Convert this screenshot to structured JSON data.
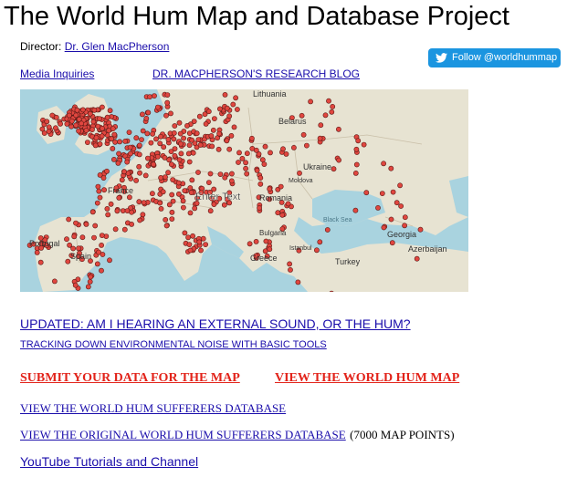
{
  "page": {
    "title": "The World Hum Map and Database Project",
    "director_label": "Director:",
    "director_name": "Dr. Glen MacPherson"
  },
  "twitter": {
    "label": "Follow @worldhummap"
  },
  "links": {
    "media": "Media Inquiries",
    "blog": "DR. MACPHERSON'S RESEARCH BLOG",
    "updated": "UPDATED: AM I HEARING AN EXTERNAL SOUND, OR THE HUM?",
    "tracking": "TRACKING DOWN ENVIRONMENTAL  NOISE WITH BASIC TOOLS",
    "submit": "SUBMIT YOUR DATA FOR THE MAP",
    "view_map": "VIEW THE WORLD HUM MAP",
    "view_db": "VIEW THE WORLD HUM SUFFERERS DATABASE",
    "view_orig": "VIEW THE ORIGINAL WORLD HUM SUFFERERS DATABASE",
    "orig_note": "(7000 MAP POINTS)",
    "youtube": "YouTube Tutorials and Channel"
  },
  "map": {
    "overlay_text": "Enter Text",
    "labels": [
      "Lithuania",
      "Belarus",
      "Ukraine",
      "Moldova",
      "Romania",
      "Black Sea",
      "Georgia",
      "Azerbaijan",
      "Turkey",
      "Portugal",
      "Spain",
      "France",
      "Bulgaria",
      "Greece",
      "Istanbul"
    ],
    "colors": {
      "water": "#a9d3df",
      "land": "#e7e3d2",
      "marker": "#e0463f"
    }
  }
}
